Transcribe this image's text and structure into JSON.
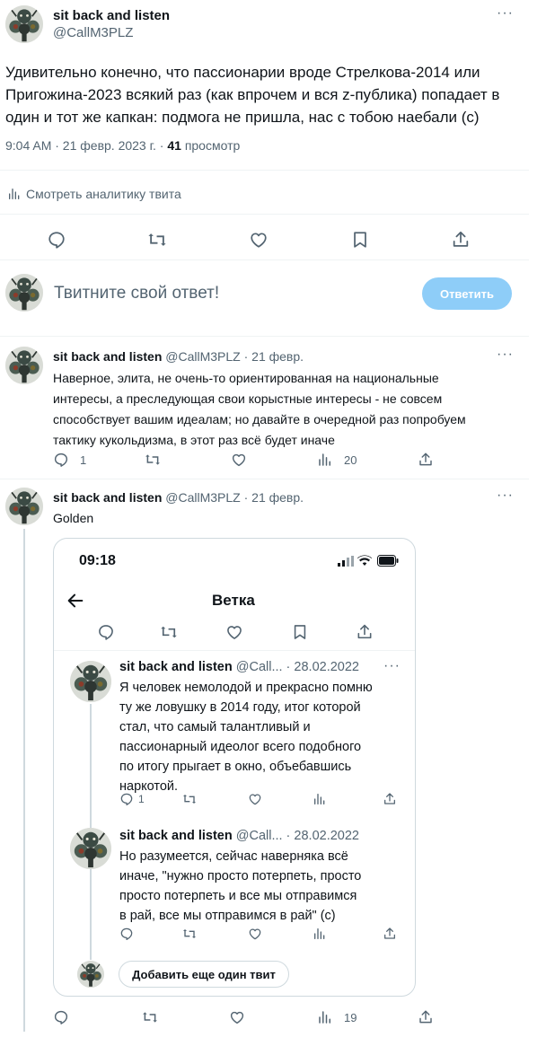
{
  "main_tweet": {
    "display_name": "sit back and listen",
    "handle": "@CallM3PLZ",
    "text_lines": [
      "Удивительно конечно, что пассионарии вроде Стрелкова-2014 или",
      "Пригожина-2023 всякий раз (как впрочем и вся z-публика) попадает в",
      "один и тот же капкан: подмога не пришла, нас с тобою наебали (с)"
    ],
    "time": "9:04 AM · 21 февр. 2023 г. ·",
    "views_count": "41",
    "views_label": "просмотр",
    "analytics_label": "Смотреть аналитику твита"
  },
  "reply_box": {
    "placeholder": "Твитните свой ответ!",
    "button_label": "Ответить"
  },
  "reply1": {
    "display_name": "sit back and listen",
    "handle_date": "@CallM3PLZ · 21 февр.",
    "text_lines": [
      "Наверное, элита, не очень-то ориентированная на национальные",
      "интересы, а преследующая свои корыстные интересы - не совсем",
      "способствует вашим идеалам; но давайте в очередной раз попробуем",
      "тактику кукольдизма, в этот раз всё будет иначе"
    ],
    "replies": "1",
    "views": "20"
  },
  "reply2": {
    "display_name": "sit back and listen",
    "handle_date": "@CallM3PLZ · 21 февр.",
    "text": "Golden",
    "views": "19"
  },
  "phone": {
    "clock": "09:18",
    "header_title": "Ветка",
    "tweet1": {
      "display_name": "sit back and listen",
      "handle_date": "@Call... · 28.02.2022",
      "text_lines": [
        "Я человек немолодой и прекрасно помню",
        "ту же ловушку в 2014 году, итог которой",
        "стал, что самый талантливый и",
        "пассионарный идеолог всего подобного",
        "по итогу прыгает в окно, объебавшись",
        "наркотой."
      ],
      "replies": "1"
    },
    "tweet2": {
      "display_name": "sit back and listen",
      "handle_date": "@Call... · 28.02.2022",
      "text_lines": [
        "Но разумеется, сейчас наверняка всё",
        "иначе, \"нужно просто потерпеть, просто",
        "просто потерпеть и все мы отправимся",
        "в рай, все мы отправимся в рай\" (с)"
      ]
    },
    "add_tweet_label": "Добавить еще один твит"
  },
  "icons": [
    "more-icon",
    "reply-icon",
    "retweet-icon",
    "like-icon",
    "bookmark-icon",
    "share-icon",
    "views-icon",
    "analytics-icon",
    "back-arrow-icon",
    "signal-icon",
    "wifi-icon",
    "battery-icon"
  ],
  "colors": {
    "accent_button": "#8ecdf8",
    "muted_text": "#536471",
    "divider": "#eff3f4"
  }
}
